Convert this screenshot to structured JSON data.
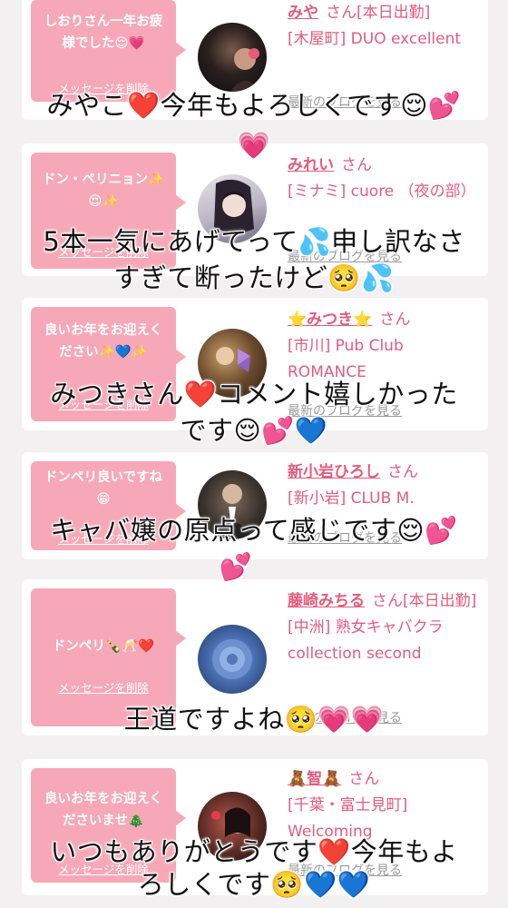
{
  "cards": [
    {
      "message": "しおりさん一年お疲様でした😌💗",
      "delete_label": "メッセージを削除",
      "name": "みや",
      "suffix": "さん[本日出勤]",
      "shop": "[木屋町] DUO excellent",
      "blog_label": "最新のブログを見る",
      "avatar_icon": "avatar-photo"
    },
    {
      "message": "ドン・ペリニョン✨😍✨",
      "delete_label": "メッセージを削除",
      "name": "みれい",
      "suffix": "さん",
      "shop": "[ミナミ] cuore （夜の部）",
      "blog_label": "最新のブログを見る",
      "avatar_icon": "avatar-photo"
    },
    {
      "message": "良いお年をお迎えください✨💙✨",
      "delete_label": "メッセージを削除",
      "name": "⭐みつき⭐",
      "suffix": "さん",
      "shop": "[市川] Pub Club ROMANCE",
      "blog_label": "最新のブログを見る",
      "avatar_icon": "avatar-photo"
    },
    {
      "message": "ドンペリ良いですね😁",
      "delete_label": "メッセージを削除",
      "name": "新小岩ひろし",
      "suffix": "さん",
      "shop": "[新小岩] CLUB M.",
      "blog_label": "最新のブログを見る",
      "avatar_icon": "avatar-photo"
    },
    {
      "message": "ドンペリ🍾🥂❤️",
      "delete_label": "メッセージを削除",
      "name": "藤崎みちる",
      "suffix": "さん[本日出勤]",
      "shop": "[中洲] 熟女キャバクラ collection second",
      "blog_label": "最新のブログを見る",
      "avatar_icon": "blue-rose-avatar"
    },
    {
      "message": "良いお年をお迎えくださいませ🎄",
      "delete_label": "メッセージを削除",
      "name": "🧸智🧸",
      "suffix": "さん",
      "shop": "[千葉・富士見町] Welcoming",
      "blog_label": "最新のブログを見る",
      "avatar_icon": "avatar-photo"
    }
  ],
  "captions": [
    {
      "text": "みやこ❤️今年もよろしくです😌💕"
    },
    {
      "text": "💗"
    },
    {
      "text": "5本一気にあげてって💦申し訳なさ"
    },
    {
      "text": "すぎて断ったけど🥺💦"
    },
    {
      "text": "みつきさん❤️コメント嬉しかった"
    },
    {
      "text": "です😌💕💙"
    },
    {
      "text": "キャバ嬢の原点って感じです😌💕"
    },
    {
      "text": "💕"
    },
    {
      "text": "王道ですよね🥺💗💗"
    },
    {
      "text": "いつもありがとうです❤️今年もよ"
    },
    {
      "text": "ろしくです🥺💙💙"
    }
  ]
}
